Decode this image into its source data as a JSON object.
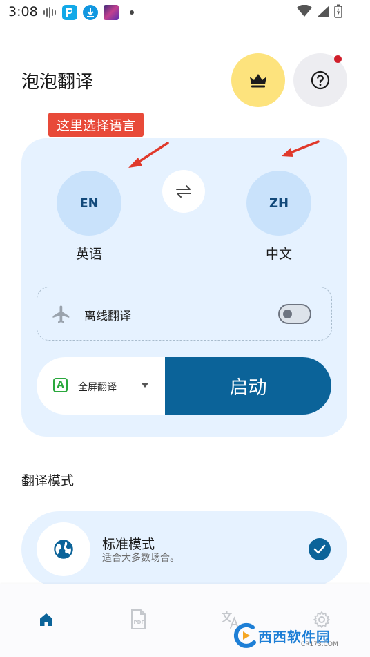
{
  "status": {
    "time": "3:08"
  },
  "header": {
    "title": "泡泡翻译"
  },
  "annotation": {
    "text": "这里选择语言"
  },
  "languages": {
    "source": {
      "code": "EN",
      "name": "英语"
    },
    "target": {
      "code": "ZH",
      "name": "中文"
    }
  },
  "offline": {
    "label": "离线翻译",
    "enabled": false
  },
  "mode_select": {
    "label": "全屏翻译"
  },
  "start_button": {
    "label": "启动"
  },
  "section": {
    "title": "翻译模式"
  },
  "mode_card": {
    "name": "标准模式",
    "description": "适合大多数场合。",
    "selected": true
  },
  "colors": {
    "primary": "#0b6399",
    "card_bg": "#e6f2ff",
    "accent_yellow": "#fde37d",
    "annotation_red": "#e84a39"
  },
  "nav": {
    "items": [
      "home-icon",
      "pdf-icon",
      "translate-icon",
      "gear-icon"
    ],
    "active_index": 0,
    "pdf_badge": "PDF"
  },
  "watermark": {
    "text": "西西软件园",
    "sub": "CR173.COM"
  }
}
